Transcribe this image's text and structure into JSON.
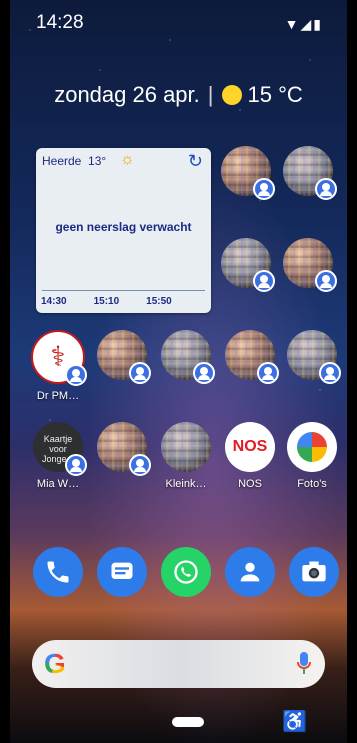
{
  "status_bar": {
    "time": "14:28",
    "icons": [
      "wifi-icon",
      "signal-icon",
      "battery-icon"
    ]
  },
  "date_widget": {
    "date": "zondag 26 apr.",
    "temp": "15 °C"
  },
  "weather_widget": {
    "location": "Heerde",
    "temp": "13°",
    "message": "geen neerslag verwacht",
    "times": [
      "14:30",
      "15:10",
      "15:50"
    ]
  },
  "apps": [
    {
      "label": "",
      "type": "contact"
    },
    {
      "label": "",
      "type": "contact"
    },
    {
      "label": "",
      "type": "contact"
    },
    {
      "label": "",
      "type": "contact"
    },
    {
      "label": "Dr PM…",
      "type": "medical"
    },
    {
      "label": "",
      "type": "contact"
    },
    {
      "label": "",
      "type": "contact"
    },
    {
      "label": "",
      "type": "contact"
    },
    {
      "label": "",
      "type": "contact"
    },
    {
      "label": "Mia W…",
      "type": "chalkboard",
      "chalk_text": "Kaartje voor Jonge..."
    },
    {
      "label": "",
      "type": "contact"
    },
    {
      "label": "Kleink…",
      "type": "contact"
    },
    {
      "label": "NOS",
      "type": "nos"
    },
    {
      "label": "Foto's",
      "type": "photos"
    }
  ],
  "dock": [
    "phone-icon",
    "messages-icon",
    "whatsapp-icon",
    "contacts-icon",
    "camera-icon"
  ],
  "search": {
    "logo": "G"
  },
  "colors": {
    "accent_blue": "#2e7bea",
    "weather_text": "#1d2a83",
    "nos_red": "#e31b23"
  }
}
